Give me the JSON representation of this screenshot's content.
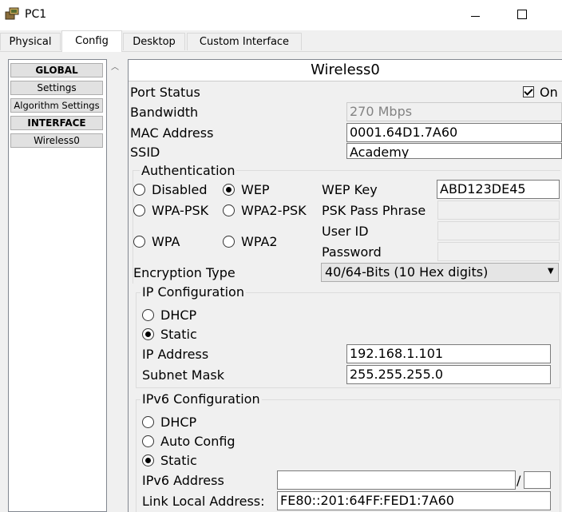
{
  "window": {
    "title": "PC1",
    "icon": "pc-icon"
  },
  "tabs": [
    {
      "label": "Physical"
    },
    {
      "label": "Config",
      "active": true
    },
    {
      "label": "Desktop"
    },
    {
      "label": "Custom Interface"
    }
  ],
  "sidebar": {
    "items": [
      {
        "label": "GLOBAL",
        "header": true
      },
      {
        "label": "Settings"
      },
      {
        "label": "Algorithm Settings"
      },
      {
        "label": "INTERFACE",
        "header": true
      },
      {
        "label": "Wireless0"
      }
    ]
  },
  "panel": {
    "title": "Wireless0",
    "port_status_label": "Port Status",
    "port_status_checkbox_label": "On",
    "port_status_on": true,
    "bandwidth_label": "Bandwidth",
    "bandwidth_value": "270 Mbps",
    "mac_label": "MAC Address",
    "mac_value": "0001.64D1.7A60",
    "ssid_label": "SSID",
    "ssid_value": "Academy"
  },
  "authentication": {
    "legend": "Authentication",
    "options": {
      "disabled": "Disabled",
      "wep": "WEP",
      "wpa_psk": "WPA-PSK",
      "wpa2_psk": "WPA2-PSK",
      "wpa": "WPA",
      "wpa2": "WPA2"
    },
    "selected": "WEP",
    "wep_key_label": "WEP Key",
    "wep_key_value": "ABD123DE45",
    "psk_label": "PSK Pass Phrase",
    "psk_value": "",
    "user_id_label": "User ID",
    "user_id_value": "",
    "password_label": "Password",
    "password_value": "",
    "encryption_label": "Encryption Type",
    "encryption_value": "40/64-Bits (10 Hex digits)"
  },
  "ip_config": {
    "legend": "IP Configuration",
    "dhcp_label": "DHCP",
    "static_label": "Static",
    "selected": "Static",
    "ip_label": "IP Address",
    "ip_value": "192.168.1.101",
    "mask_label": "Subnet Mask",
    "mask_value": "255.255.255.0"
  },
  "ipv6_config": {
    "legend": "IPv6 Configuration",
    "dhcp_label": "DHCP",
    "auto_label": "Auto Config",
    "static_label": "Static",
    "selected": "Static",
    "address_label": "IPv6 Address",
    "address_value": "",
    "separator": "/",
    "prefix_value": "",
    "link_local_label": "Link Local Address:",
    "link_local_value": "FE80::201:64FF:FED1:7A60"
  }
}
